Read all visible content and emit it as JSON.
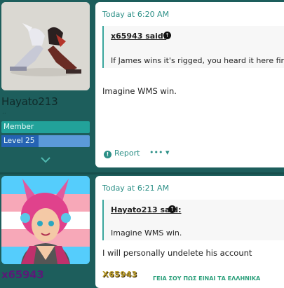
{
  "posts": [
    {
      "username": "Hayato213",
      "user_marker": "..",
      "role_badge": "Member",
      "level_badge": "Level 25",
      "timestamp": "Today at 6:20 AM",
      "quote": {
        "author_label": "x65943 said:",
        "text": "If James wins it's rigged, you heard it here first"
      },
      "message": "Imagine WMS win.",
      "actions": {
        "report_label": "Report",
        "more_label": "••• ▾"
      }
    },
    {
      "username": "x65943",
      "timestamp": "Today at 6:21 AM",
      "quote": {
        "author_label": "Hayato213 said:",
        "text": "Imagine WMS win."
      },
      "message": "I will personally undelete his account",
      "signature": {
        "text": "X65943",
        "subtext": "ΓΕΙΑ ΣΟΥ ΠΩΣ ΕΙΝΑΙ ΤΑ ΕΛΛΗΝΙΚΑ"
      }
    }
  ],
  "colors": {
    "page_bg": "#1d5e5c",
    "accent": "#2b8f86",
    "member_badge": "#22a29a",
    "level_badge": "#2563b3",
    "username2": "#5a1a78"
  },
  "icons": {
    "quote_jump": "arrow-up-circle-icon",
    "report": "alert-circle-icon",
    "expand": "chevron-down-icon"
  }
}
